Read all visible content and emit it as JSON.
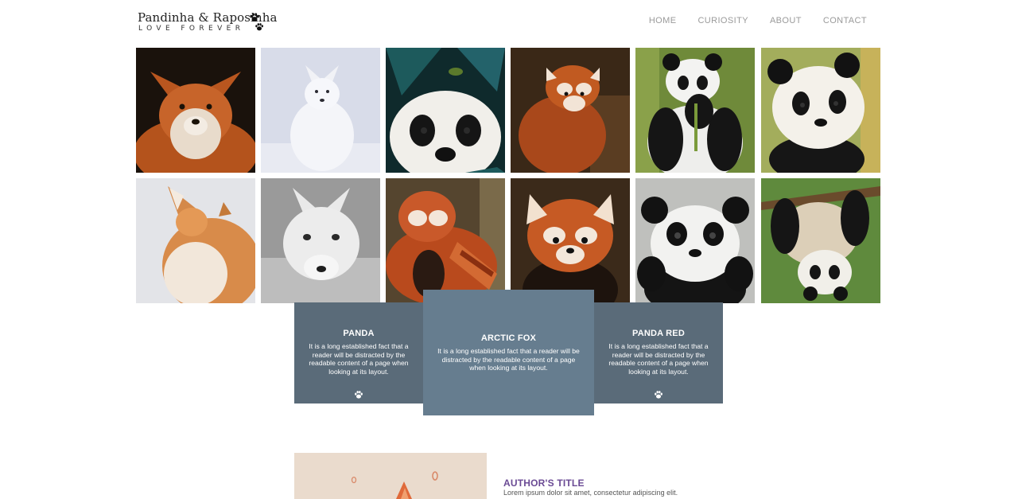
{
  "header": {
    "logo_title": "Pandinha & Raposinha",
    "logo_subtitle": "LOVE FOREVER",
    "nav": [
      "HOME",
      "CURIOSITY",
      "ABOUT",
      "CONTACT"
    ]
  },
  "gallery": {
    "images": [
      {
        "subject": "red fox"
      },
      {
        "subject": "arctic fox"
      },
      {
        "subject": "panda with frog"
      },
      {
        "subject": "red panda"
      },
      {
        "subject": "panda eating bamboo"
      },
      {
        "subject": "panda cub"
      },
      {
        "subject": "red fox in snow"
      },
      {
        "subject": "arctic fox"
      },
      {
        "subject": "red panda sleeping"
      },
      {
        "subject": "red panda"
      },
      {
        "subject": "panda cub"
      },
      {
        "subject": "panda upside down"
      }
    ]
  },
  "cards": [
    {
      "title": "PANDA",
      "text": "It is a long established fact that a reader will be distracted by the readable content of a page when looking at its layout."
    },
    {
      "title": "ARCTIC FOX",
      "text": "It is a long established fact that a reader will be distracted by the readable content of a page when looking at its layout."
    },
    {
      "title": "PANDA RED",
      "text": "It is a long established fact that a reader will be distracted by the readable content of a page when looking at its layout."
    }
  ],
  "author": {
    "title": "AUTHOR'S TITLE",
    "text": "Lorem ipsum dolor sit amet, consectetur adipiscing elit."
  },
  "colors": {
    "card_side": "#5a6b79",
    "card_center": "#667d8f",
    "nav_text": "#9a9a9a",
    "author_title": "#6a4a94"
  },
  "icons": {
    "logo": "paw-icon",
    "card": "paw-icon"
  }
}
